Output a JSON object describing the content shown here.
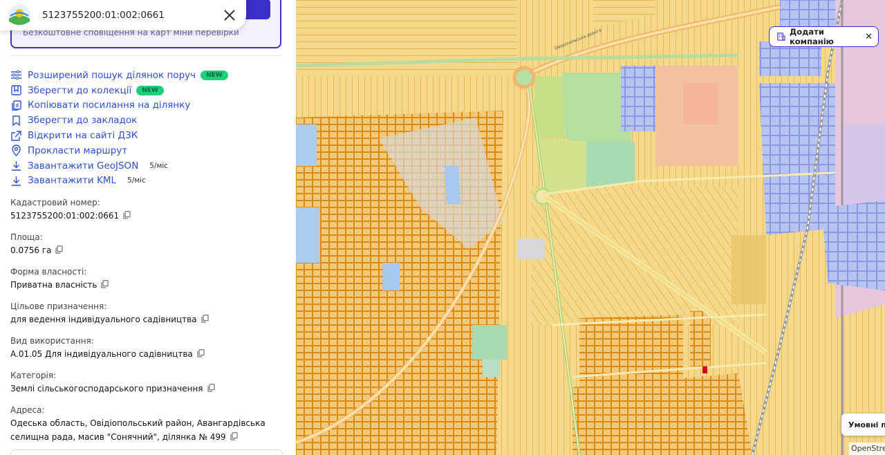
{
  "header": {
    "search_value": "5123755200:01:002:0661"
  },
  "promo": {
    "text": "Безкоштовне сповіщення на карт міни перевірки"
  },
  "actions": [
    {
      "label": "Розширений пошук ділянок поруч",
      "badge": "NEW"
    },
    {
      "label": "Зберегти до колекції",
      "badge": "NEW"
    },
    {
      "label": "Копіювати посилання на ділянку"
    },
    {
      "label": "Зберегти до закладок"
    },
    {
      "label": "Відкрити на сайті ДЗК"
    },
    {
      "label": "Прокласти маршрут"
    },
    {
      "label": "Завантажити GeoJSON",
      "limit": "5/міс"
    },
    {
      "label": "Завантажити KML",
      "limit": "5/міс"
    }
  ],
  "fields": {
    "cadastral": {
      "label": "Кадастровий номер:",
      "value": "5123755200:01:002:0661"
    },
    "area": {
      "label": "Площа:",
      "value": "0.0756 га"
    },
    "ownership": {
      "label": "Форма власності:",
      "value": "Приватна власність"
    },
    "purpose": {
      "label": "Цільове призначення:",
      "value": "для ведення індивідуального садівництва"
    },
    "usage": {
      "label": "Вид використання:",
      "value": "A.01.05 Для індивідуального садівництва"
    },
    "category": {
      "label": "Категорія:",
      "value": "Землі сільськогосподарського призначення"
    },
    "address": {
      "label": "Адреса:",
      "value": "Одеська область, Овідіопольський район, Авангардівська селищна рада, масив \"Сонячний\", ділянка № 499"
    }
  },
  "map": {
    "add_company_label": "Додати компанію",
    "legend_label": "Умовні по",
    "attribution": "OpenStre",
    "road_label": "Овідіопольська дорога"
  },
  "colors": {
    "accent": "#3b2fc9",
    "link": "#2c4fd8",
    "badge": "#1ed07a",
    "parcel_fill": "#f4d98a",
    "parcel_stroke": "#e0901a",
    "selected_parcel": "#d0021b"
  }
}
